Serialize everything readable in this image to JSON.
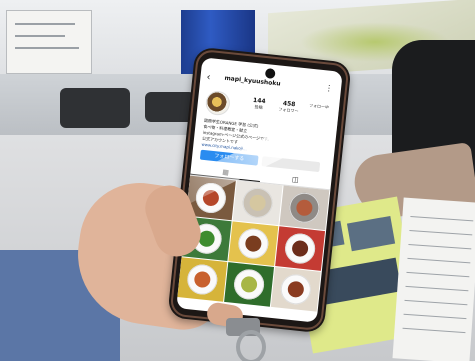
{
  "phone": {
    "username": "mapi_kyuushoku",
    "stats": [
      {
        "value": "144",
        "label": "投稿"
      },
      {
        "value": "458",
        "label": "フォロワー"
      },
      {
        "value": "",
        "label": "フォロー中"
      }
    ],
    "bio_lines": [
      "国際学生ORANGE 学習 (公式)",
      "食べ物・料理教室・献立",
      "instagram-ページ公式のページです。",
      "公式アカウントです",
      "www.city.mapi.nakoji..."
    ],
    "follow_label": "フォローする",
    "tabs": [
      "▦",
      "◫"
    ],
    "colors": {
      "follow_button": "#2a8cf0",
      "phone_frame": "#1c1715",
      "sleeve": "#5b76a6"
    }
  }
}
